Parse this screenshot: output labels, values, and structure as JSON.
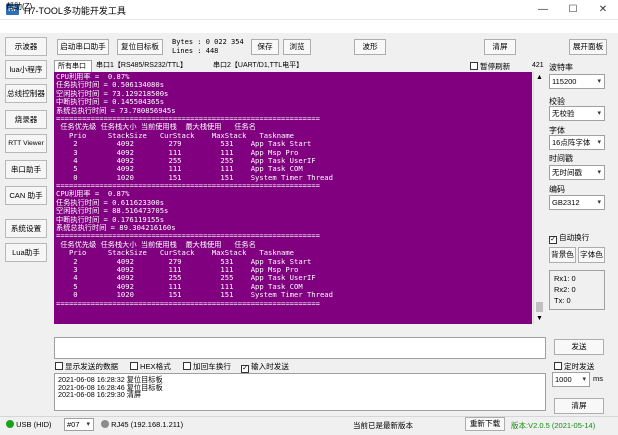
{
  "window": {
    "icon_text": "H7",
    "title": "H7-TOOL多功能开发工具",
    "minimize": "—",
    "maximize": "☐",
    "close": "✕"
  },
  "menu": {
    "help": "帮助(Z)"
  },
  "sidebar": {
    "items": [
      "示波器",
      "lua小程序",
      "总线控制器",
      "烧录器",
      "RTT Viewer",
      "串口助手",
      "CAN 助手",
      "系统设置",
      "Lua助手"
    ]
  },
  "toolbar": {
    "start_helper": "启动串口助手",
    "reset_target": "复位目标板",
    "bytes_label": "Bytes :",
    "bytes_value": "0 022 354",
    "lines_label": "Lines :",
    "lines_value": "448",
    "save": "保存",
    "browse": "浏览",
    "waveform": "波形",
    "clear": "清屏",
    "expand": "展开面板"
  },
  "tabs": [
    "所有串口",
    "串口1【RS485/RS232/TTL】",
    "串口2【UART/D1,TTL电平】"
  ],
  "pause_refresh": "暂停刷新",
  "count_421": "421",
  "console_lines": [
    "CPU利用率 =  0.87%",
    "任务执行时间 = 0.506134080s",
    "空闲执行时间 = 73.129218500s",
    "中断执行时间 = 0.145504365s",
    "系统总执行时间 = 73.780856945s",
    "=============================================================",
    " 任务优先级 任务栈大小 当前使用栈  最大栈使用   任务名",
    "   Prio     StackSize   CurStack    MaxStack   Taskname",
    "    2         4092        279         531    App Task Start",
    "    3         4092        111         111    App Msp Pro",
    "    4         4092        255         255    App Task UserIF",
    "    5         4092        111         111    App Task COM",
    "    0         1020        151         151    System Timer Thread",
    "=============================================================",
    "CPU利用率 =  0.87%",
    "任务执行时间 = 0.611623300s",
    "空闲执行时间 = 88.516473705s",
    "中断执行时间 = 0.176119155s",
    "系统总执行时间 = 89.304216160s",
    "=============================================================",
    " 任务优先级 任务栈大小 当前使用栈  最大栈使用   任务名",
    "   Prio     StackSize   CurStack    MaxStack   Taskname",
    "    2         4092        279         531    App Task Start",
    "    3         4092        111         111    App Msp Pro",
    "    4         4092        255         255    App Task UserIF",
    "    5         4092        111         111    App Task COM",
    "    0         1020        151         151    System Timer Thread",
    "============================================================="
  ],
  "send": {
    "button": "发送",
    "input_value": ""
  },
  "options": {
    "show_sent": "显示发送的数据",
    "hex": "HEX格式",
    "add_crlf": "加回车换行",
    "input_send": "输入时发送",
    "timed_send": "定时发送",
    "interval": "1000",
    "interval_unit": "ms"
  },
  "log_lines": [
    "2021-06-08 16:28:32 复位目标板",
    "2021-06-08 16:28:46 复位目标板",
    "2021-06-08 16:29:30 清屏"
  ],
  "right_panel": {
    "baud_label": "波特率",
    "baud_value": "115200",
    "parity_label": "校验",
    "parity_value": "无校验",
    "font_label": "字体",
    "font_value": "16点阵字体",
    "timestamp_label": "时间戳",
    "timestamp_value": "无时间戳",
    "encoding_label": "编码",
    "encoding_value": "GB2312",
    "auto_newline": "自动换行",
    "bg_color": "背景色",
    "font_color": "字体色",
    "rx1_label": "Rx1:",
    "rx1_value": "0",
    "rx2_label": "Rx2:",
    "rx2_value": "0",
    "tx_label": "Tx:",
    "tx_value": "0",
    "clear": "清屏"
  },
  "status": {
    "usb": "USB (HID)",
    "device": "#07",
    "rj45": "RJ45 (192.168.1.211)",
    "latest": "当前已是最新版本",
    "redownload": "重新下载",
    "version": "版本:V2.0.5 (2021-05-14)"
  },
  "colors": {
    "console_bg": "#800080",
    "usb_dot": "#1aa31a",
    "rj45_dot": "#8c8c8c",
    "version_text": "#138a13"
  }
}
